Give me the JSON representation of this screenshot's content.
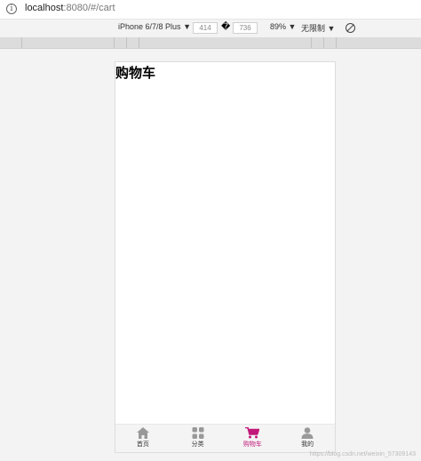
{
  "browser": {
    "url_host": "localhost",
    "url_rest": ":8080/#/cart"
  },
  "devtools": {
    "device": "iPhone 6/7/8 Plus",
    "width": "414",
    "height": "736",
    "zoom": "89%",
    "throttle": "无限制",
    "dim_separator": "�"
  },
  "page": {
    "title": "购物车"
  },
  "tabbar": {
    "items": [
      {
        "label": "首页",
        "icon": "home-icon",
        "active": false
      },
      {
        "label": "分类",
        "icon": "grid-icon",
        "active": false
      },
      {
        "label": "购物车",
        "icon": "cart-icon",
        "active": true
      },
      {
        "label": "我的",
        "icon": "user-icon",
        "active": false
      }
    ]
  },
  "watermark": "https://blog.csdn.net/weixin_57309143",
  "colors": {
    "active": "#c2187a",
    "inactive_icon": "#999999"
  }
}
